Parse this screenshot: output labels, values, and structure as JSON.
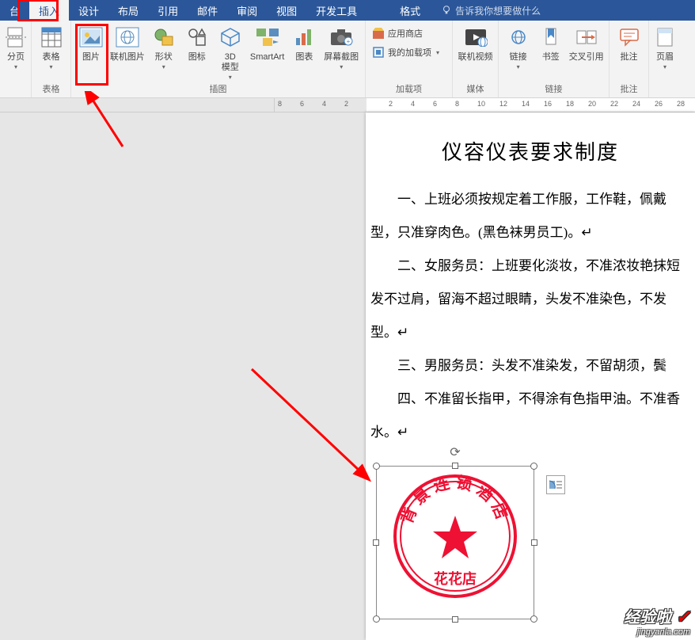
{
  "tabs": {
    "start_partial": "台",
    "insert": "插入",
    "design": "设计",
    "layout": "布局",
    "references": "引用",
    "mail": "邮件",
    "review": "审阅",
    "view": "视图",
    "devtools": "开发工具",
    "format": "格式",
    "tell_me": "告诉我你想要做什么"
  },
  "ribbon": {
    "pages": {
      "page_break": "分页"
    },
    "tables_group": {
      "label": "表格",
      "table": "表格"
    },
    "illustrations_group": {
      "label": "插图",
      "picture": "图片",
      "online_pic": "联机图片",
      "shapes": "形状",
      "icons": "图标",
      "model3d_l1": "3D",
      "model3d_l2": "模型",
      "smartart": "SmartArt",
      "chart": "图表",
      "screenshot": "屏幕截图"
    },
    "addins_group": {
      "label": "加载项",
      "store": "应用商店",
      "my_addins": "我的加载项"
    },
    "media_group": {
      "label": "媒体",
      "online_video": "联机视频"
    },
    "links_group": {
      "label": "链接",
      "hyperlink": "链接",
      "bookmark": "书签",
      "crossref": "交叉引用"
    },
    "comments_group": {
      "label": "批注",
      "comment": "批注"
    },
    "header_footer": {
      "header": "页眉"
    }
  },
  "ruler_ticks": [
    "8",
    "6",
    "4",
    "2",
    "",
    "2",
    "4",
    "6",
    "8",
    "10",
    "12",
    "14",
    "16",
    "18",
    "20",
    "22",
    "24",
    "26",
    "28"
  ],
  "document": {
    "title": "仪容仪表要求制度",
    "p1": "一、上班必须按规定着工作服，工作鞋，佩戴型，只准穿肉色。(黑色袜男员工)。↵",
    "p2": "二、女服务员：上班要化淡妆，不准浓妆艳抹短发不过肩，留海不超过眼睛，头发不准染色，不发型。↵",
    "p3": "三、男服务员：头发不准染发，不留胡须，鬓",
    "p4": "四、不准留长指甲，不得涂有色指甲油。不准香水。↵"
  },
  "stamp": {
    "arc_text": "背景连锁酒店",
    "bottom_text": "花花店"
  },
  "watermark": {
    "line1": "经验啦",
    "check": "✓",
    "line2": "jingyanla.com"
  }
}
